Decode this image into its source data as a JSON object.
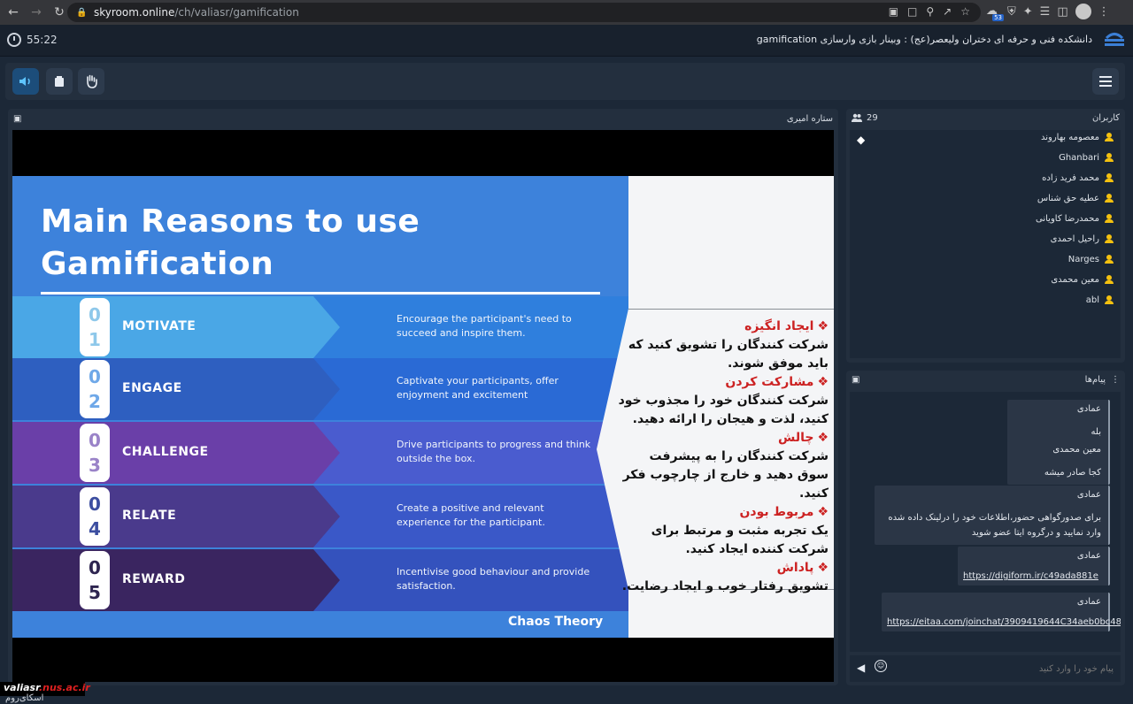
{
  "browser": {
    "url_host": "skyroom.online",
    "url_path": "/ch/valiasr/gamification",
    "extension_badge": "53"
  },
  "header": {
    "timer": "55:22",
    "room_title": "دانشکده فنی و حرفه ای دختران ولیعصر(عج) : وبینار بازی وارسازی gamification"
  },
  "video": {
    "presenter": "ستاره امیری",
    "slide": {
      "title_line1": "Main Reasons to use",
      "title_line2": "Gamification",
      "rows": [
        {
          "d1": "0",
          "d2": "1",
          "label": "MOTIVATE",
          "desc": "Encourage the participant's need to succeed and inspire them.",
          "color": "#4aa7e6",
          "right": "#2f7fdd",
          "digit_color": "#8ec8ea"
        },
        {
          "d1": "0",
          "d2": "2",
          "label": "ENGAGE",
          "desc": "Captivate your participants, offer enjoyment and excitement",
          "color": "#2e5fc0",
          "right": "#2a6ad5",
          "digit_color": "#6fa8e8"
        },
        {
          "d1": "0",
          "d2": "3",
          "label": "CHALLENGE",
          "desc": "Drive participants to progress and think outside the box.",
          "color": "#6a3fa8",
          "right": "#4a5ccf",
          "digit_color": "#9a83c8"
        },
        {
          "d1": "0",
          "d2": "4",
          "label": "RELATE",
          "desc": "Create a positive and relevant experience for the participant.",
          "color": "#4a3a8c",
          "right": "#3a58c8",
          "digit_color": "#3c4ea0"
        },
        {
          "d1": "0",
          "d2": "5",
          "label": "REWARD",
          "desc": "Incentivise good behaviour and provide satisfaction.",
          "color": "#3a2560",
          "right": "#3452bd",
          "digit_color": "#2e2550"
        }
      ],
      "brand": "Chaos Theory",
      "fa_items": [
        {
          "head": "ایجاد انگیزه",
          "body": "شرکت کنندگان را تشویق کنید که باید موفق شوند."
        },
        {
          "head": "مشارکت کردن",
          "body": "شرکت کنندگان خود را مجذوب خود کنید، لذت و هیجان را ارائه دهید."
        },
        {
          "head": "چالش",
          "body": "شرکت کنندگان را به پیشرفت سوق دهید و خارج از چارچوب فکر کنید."
        },
        {
          "head": "مربوط بودن",
          "body": "یک تجربه مثبت و مرتبط برای شرکت کننده ایجاد کنید."
        },
        {
          "head": "پاداش",
          "body": "تشویق رفتار خوب و ایجاد رضایت."
        }
      ]
    }
  },
  "watermark": {
    "part1": "valiasr",
    "part2": ".nus.ac.ir"
  },
  "footer_brand": "اسکای‌روم",
  "users": {
    "title": "کاربران",
    "count": "29",
    "list": [
      "معصومه بهاروند",
      "Ghanbari",
      "محمد فرید زاده",
      "عطیه حق شناس",
      "محمدرضا کاویانی",
      "راحیل احمدی",
      "Narges",
      "معین محمدی",
      "abl"
    ]
  },
  "messages": {
    "title": "پیام‌ها",
    "items": [
      {
        "sender": "عمادی",
        "body": "بله"
      },
      {
        "sender": "معین محمدی",
        "body": "کجا صادر میشه"
      },
      {
        "sender": "عمادی",
        "body": "برای صدورگواهی حضور،اطلاعات خود را درلینک داده شده وارد نمایید و درگروه ایتا عضو شوید"
      },
      {
        "sender": "عمادی",
        "link": "https://digiform.ir/c49ada881e"
      },
      {
        "sender": "عمادی",
        "link": "https://eitaa.com/joinchat/3909419644C34aeb0bc48"
      }
    ],
    "placeholder": "پیام خود را وارد کنید"
  }
}
